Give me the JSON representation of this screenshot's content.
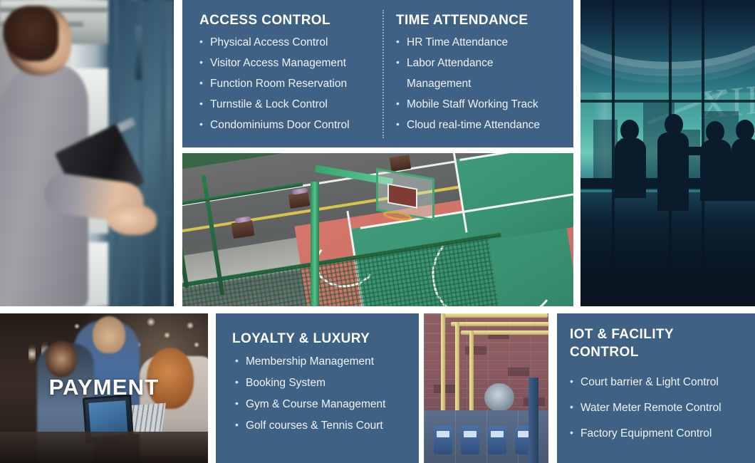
{
  "panels": {
    "access_control": {
      "title": "ACCESS CONTROL",
      "items": [
        "Physical Access Control",
        "Visitor Access Management",
        "Function Room Reservation",
        "Turnstile & Lock Control",
        "Condominiums Door Control"
      ]
    },
    "time_attendance": {
      "title": "TIME ATTENDANCE",
      "items": [
        "HR Time Attendance",
        "Labor Attendance",
        "Mobile Staff Working Track",
        "Cloud real-time Attendance"
      ],
      "item_2_continuation": "Management"
    },
    "loyalty_luxury": {
      "title": "LOYALTY & LUXURY",
      "items": [
        "Membership Management",
        "Booking System",
        "Gym & Course Management",
        "Golf courses & Tennis Court"
      ]
    },
    "iot_facility": {
      "title_line1": "IOT & FACILITY",
      "title_line2": "CONTROL",
      "items": [
        "Court barrier & Light Control",
        "Water Meter Remote Control",
        "Factory Equipment Control"
      ]
    }
  },
  "images": {
    "access_photo_caption": "",
    "payment_overlay_label": "PAYMENT",
    "clock_numeral": "XII"
  },
  "colors": {
    "panel_blue": "#3f6184",
    "panel_text": "#ffffff",
    "bullet_text": "#eef3f8",
    "page_background": "#ffffff"
  }
}
